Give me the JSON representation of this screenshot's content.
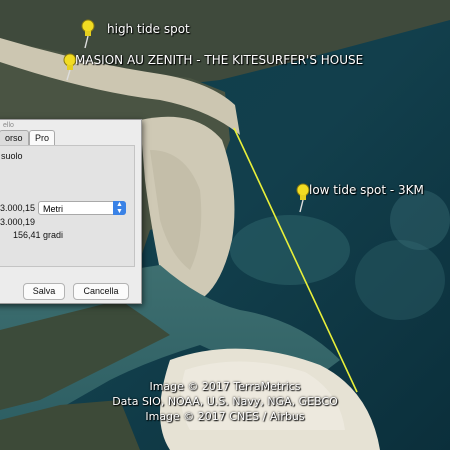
{
  "map": {
    "pins": [
      {
        "label": "high tide spot"
      },
      {
        "label": "MASION AU ZENITH - THE KITESURFER'S HOUSE"
      },
      {
        "label": "low tide spot - 3KM"
      }
    ],
    "credits": [
      "Image © 2017 TerraMetrics",
      "Data SIO, NOAA, U.S. Navy, NGA, GEBCO",
      "Image © 2017 CNES / Airbus"
    ],
    "colors": {
      "pin": "#f2dc22",
      "path_line": "#e8f03a",
      "sea": "#0e3a45",
      "sand": "#d9d3c0"
    }
  },
  "dialog": {
    "title": "ello",
    "tabs": [
      "orso",
      "Pro"
    ],
    "ground_label": "suolo",
    "value_1": "3.000,15",
    "unit_select": "Metri",
    "value_2": "3.000,19",
    "angle": "156,41 gradi",
    "save_button": "Salva",
    "cancel_button": "Cancella"
  }
}
